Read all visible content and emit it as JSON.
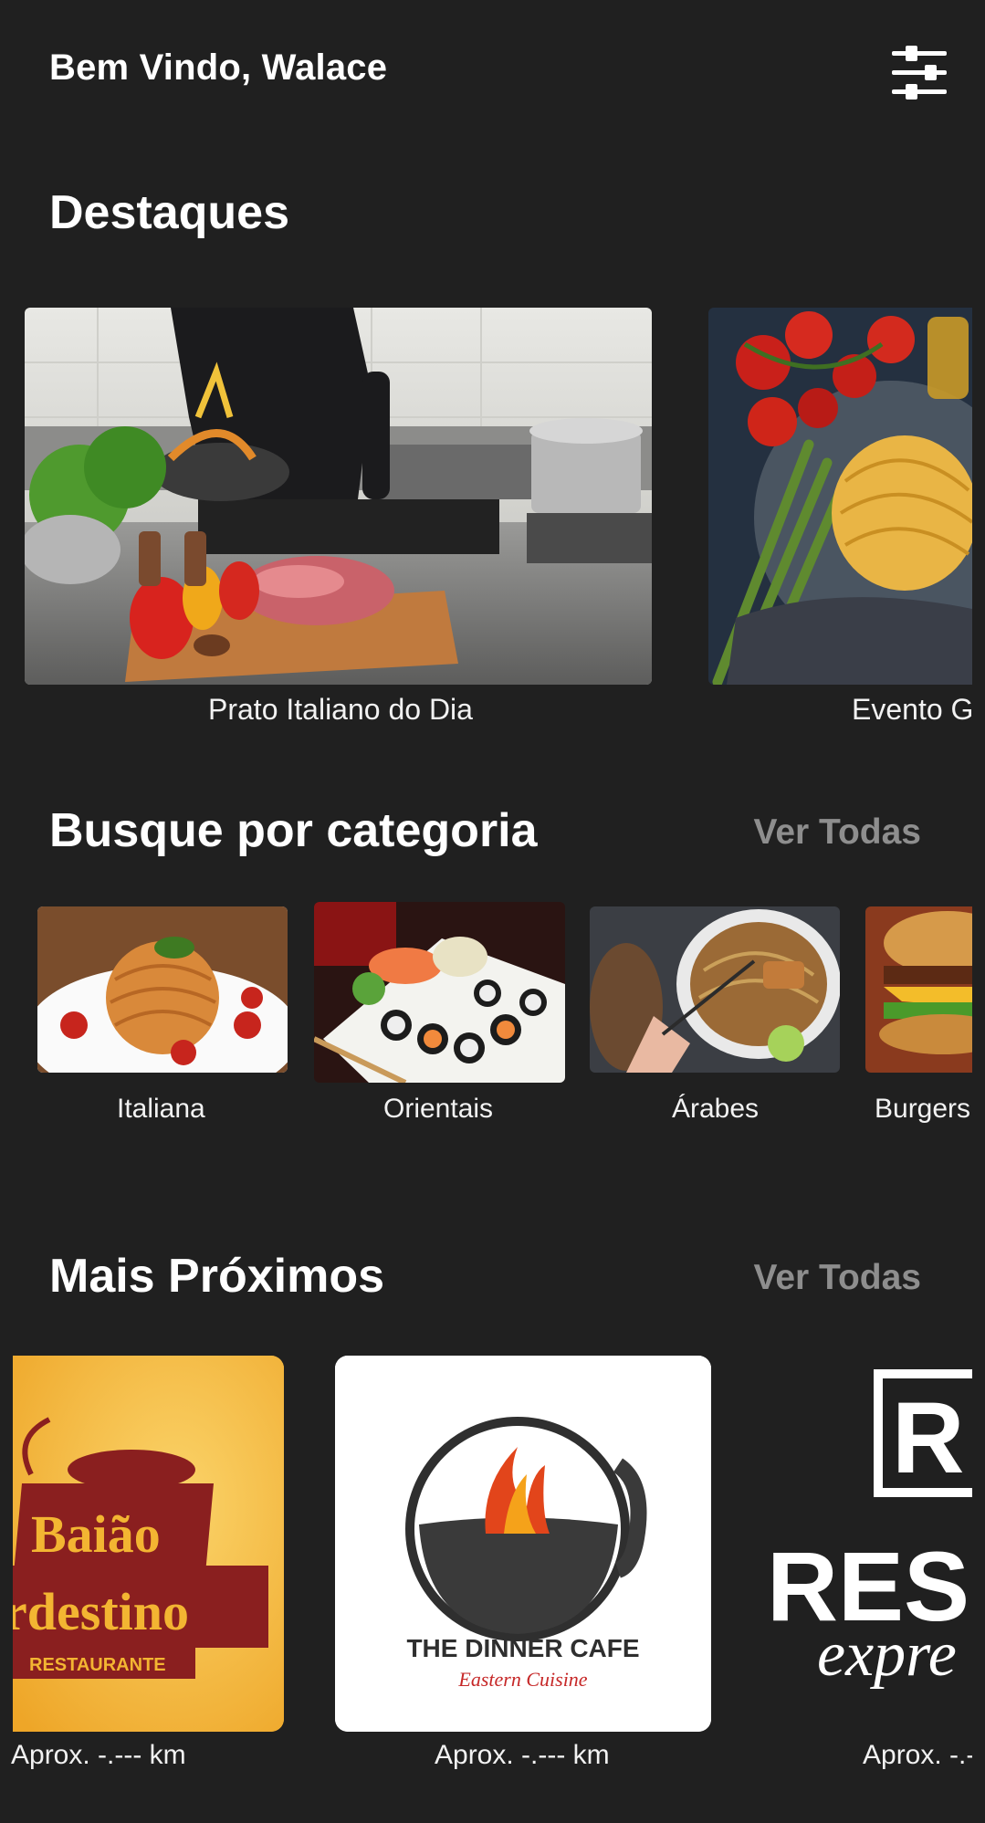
{
  "header": {
    "greeting": "Bem Vindo, Walace",
    "filter_icon": "sliders-icon"
  },
  "highlights": {
    "title": "Destaques",
    "items": [
      {
        "caption": "Prato Italiano do Dia"
      },
      {
        "caption": "Evento G"
      }
    ]
  },
  "categories": {
    "title": "Busque por categoria",
    "see_all": "Ver Todas",
    "items": [
      {
        "label": "Italiana"
      },
      {
        "label": "Orientais"
      },
      {
        "label": "Árabes"
      },
      {
        "label": "Burgers"
      }
    ]
  },
  "nearby": {
    "title": "Mais Próximos",
    "see_all": "Ver Todas",
    "items": [
      {
        "logo_line1": "Baião",
        "logo_line2": "rdestino",
        "logo_line3": "RESTAURANTE",
        "distance": "Aprox. -.--- km"
      },
      {
        "logo_line1": "THE DINNER CAFE",
        "logo_line2": "Eastern Cuisine",
        "distance": "Aprox. -.--- km"
      },
      {
        "logo_line1": "R",
        "logo_line2": "RES",
        "logo_line3": "expre",
        "distance": "Aprox. -.-"
      }
    ]
  },
  "colors": {
    "background": "#202020",
    "muted_link": "#8e8e8e",
    "baiao_yellow": "#f3b532",
    "baiao_red": "#8a1f1f"
  }
}
